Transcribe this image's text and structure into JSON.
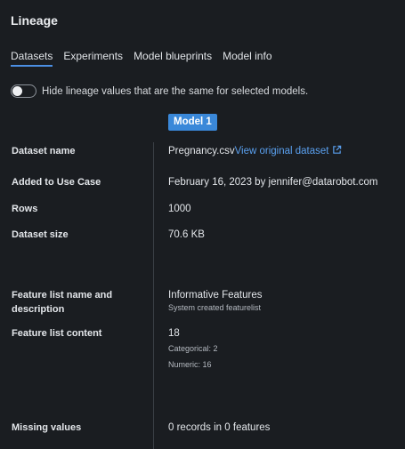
{
  "panel": {
    "title": "Lineage"
  },
  "tabs": [
    {
      "label": "Datasets",
      "active": true
    },
    {
      "label": "Experiments",
      "active": false
    },
    {
      "label": "Model blueprints",
      "active": false
    },
    {
      "label": "Model info",
      "active": false
    }
  ],
  "toggle": {
    "label": "Hide lineage values that are the same for selected models.",
    "on": false
  },
  "model": {
    "badge": "Model 1"
  },
  "rows": {
    "dataset_name": {
      "label": "Dataset name",
      "value": "Pregnancy.csv",
      "link": "View original dataset",
      "icon": "external-link-icon"
    },
    "added": {
      "label": "Added to Use Case",
      "value": "February 16, 2023 by jennifer@datarobot.com"
    },
    "rows_count": {
      "label": "Rows",
      "value": "1000"
    },
    "dataset_size": {
      "label": "Dataset size",
      "value": "70.6 KB"
    },
    "feature_list": {
      "label": "Feature list name and description",
      "value": "Informative Features",
      "subvalue": "System created featurelist"
    },
    "feature_content": {
      "label": "Feature list content",
      "value": "18",
      "categorical": "Categorical: 2",
      "numeric": "Numeric: 16"
    },
    "missing": {
      "label": "Missing values",
      "value": "0 records in 0 features"
    }
  },
  "colors": {
    "background": "#1a1d21",
    "accent": "#3a88d9",
    "link": "#5aa0ef"
  }
}
